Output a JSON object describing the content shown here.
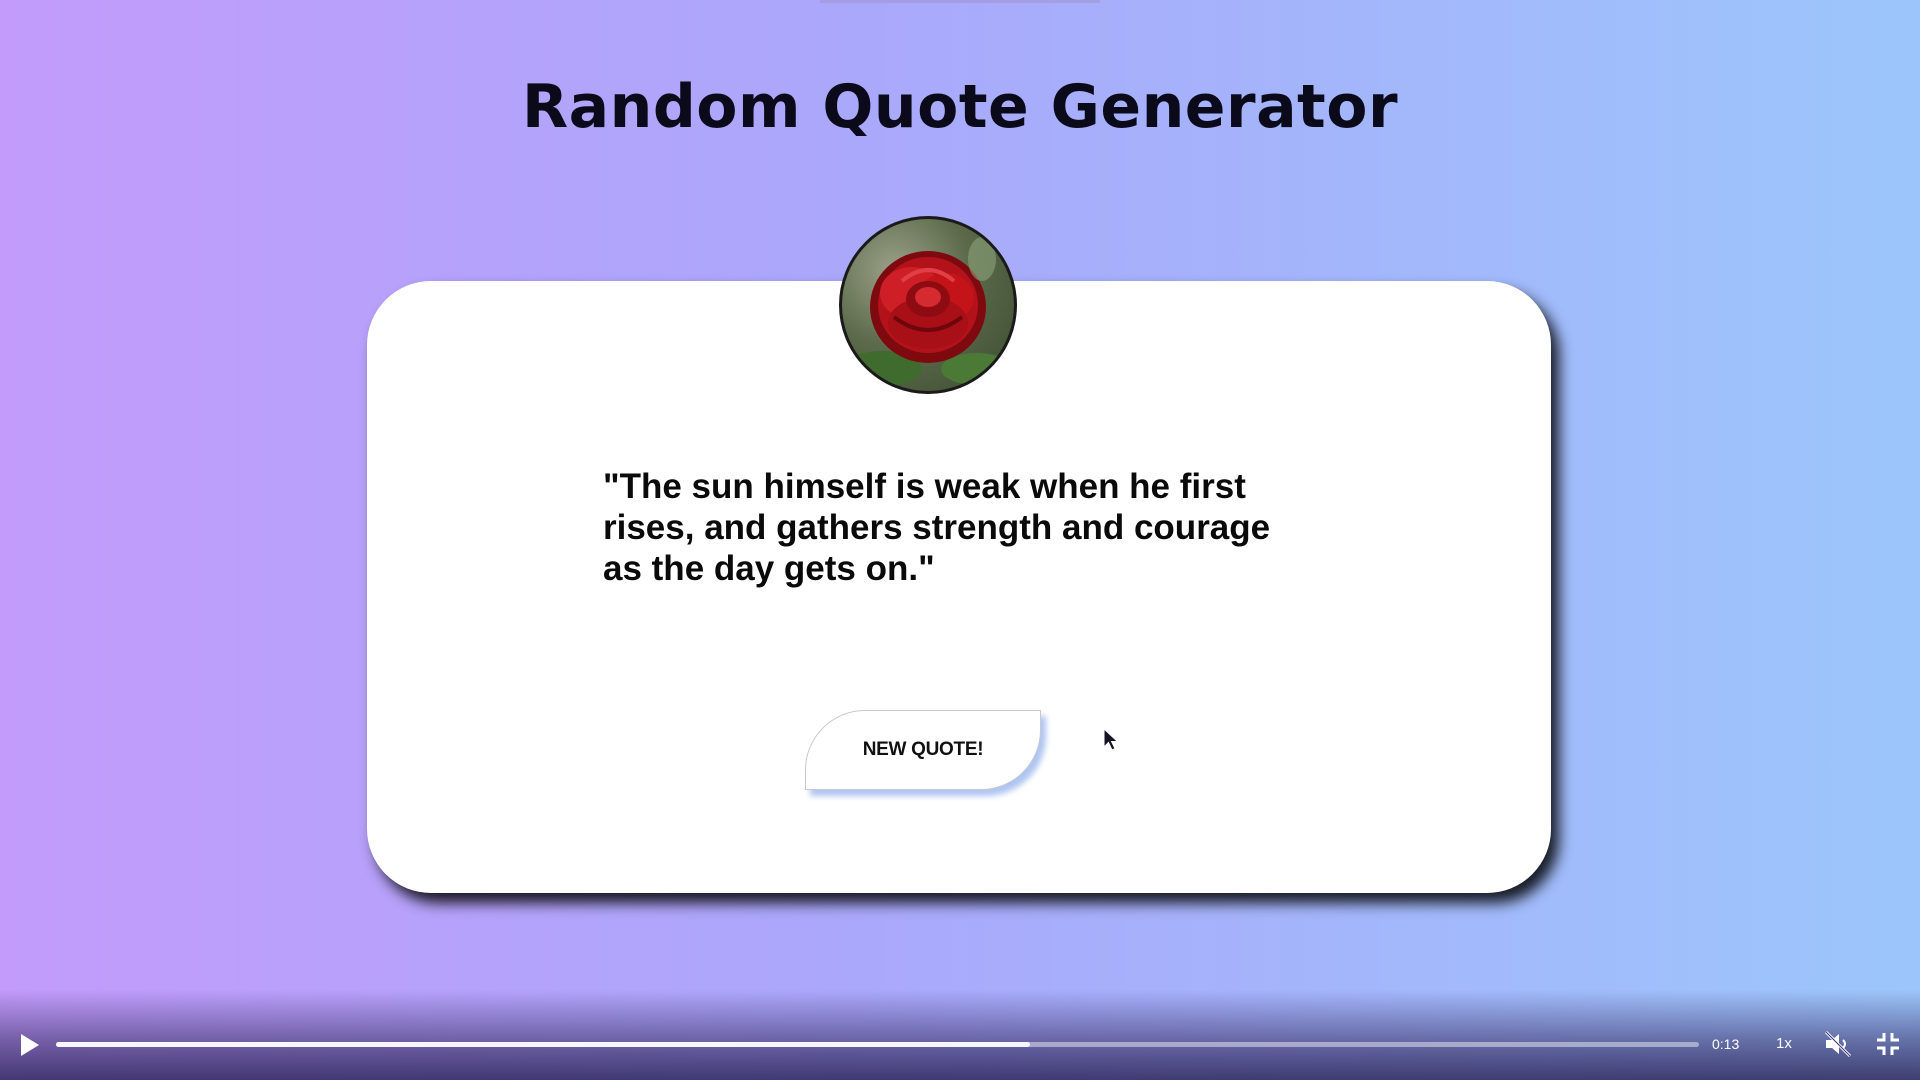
{
  "page": {
    "title": "Random Quote Generator"
  },
  "quote": {
    "line1": "\"The sun himself is weak when he first",
    "line2": "rises, and gathers strength and courage",
    "line3": "as the day gets on.\""
  },
  "button": {
    "label": "NEW QUOTE!"
  },
  "avatar": {
    "icon": "rose-image"
  },
  "player": {
    "time": "0:13",
    "speed": "1x",
    "progress_fraction": 0.593,
    "muted": true
  },
  "colors": {
    "gradient_left": "#c29bfb",
    "gradient_mid": "#aaa8fb",
    "gradient_right": "#9cc6fb",
    "card": "#ffffff",
    "rose": "#c4141a"
  }
}
